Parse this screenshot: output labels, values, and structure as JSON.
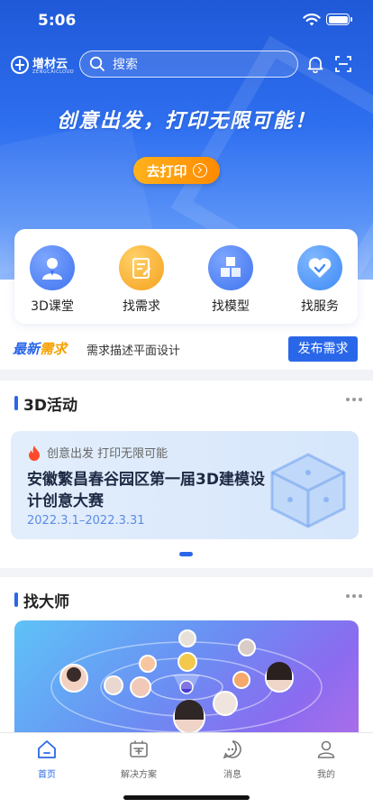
{
  "status_bar": {
    "time": "5:06"
  },
  "header": {
    "logo_name": "增材云",
    "logo_sub": "ZENGCAICLOUD",
    "search_placeholder": "搜索"
  },
  "hero": {
    "slogan": "创意出发，打印无限可能！",
    "cta_label": "去打印"
  },
  "services": [
    {
      "label": "3D课堂",
      "icon": "teacher-icon",
      "color": "#3f74ef"
    },
    {
      "label": "找需求",
      "icon": "notepad-icon",
      "color": "#f5a21c"
    },
    {
      "label": "找模型",
      "icon": "cubes-icon",
      "color": "#3f74ef"
    },
    {
      "label": "找服务",
      "icon": "heart-icon",
      "color": "#3f8af5"
    }
  ],
  "demand": {
    "tag_part1": "最新",
    "tag_part2": "需求",
    "text": "需求描述平面设计",
    "button": "发布需求"
  },
  "activity": {
    "section_title": "3D活动",
    "banner_subtitle": "创意出发 打印无限可能",
    "banner_title": "安徽繁昌春谷园区第一届3D建模设计创意大赛",
    "banner_date": "2022.3.1–2022.3.31"
  },
  "masters": {
    "section_title": "找大师"
  },
  "tabbar": [
    {
      "label": "首页",
      "icon": "home-icon",
      "active": true
    },
    {
      "label": "解决方案",
      "icon": "solution-icon",
      "active": false
    },
    {
      "label": "消息",
      "icon": "message-icon",
      "active": false
    },
    {
      "label": "我的",
      "icon": "profile-icon",
      "active": false
    }
  ],
  "colors": {
    "primary": "#2a67e8",
    "accent_orange": "#ff8a00"
  }
}
